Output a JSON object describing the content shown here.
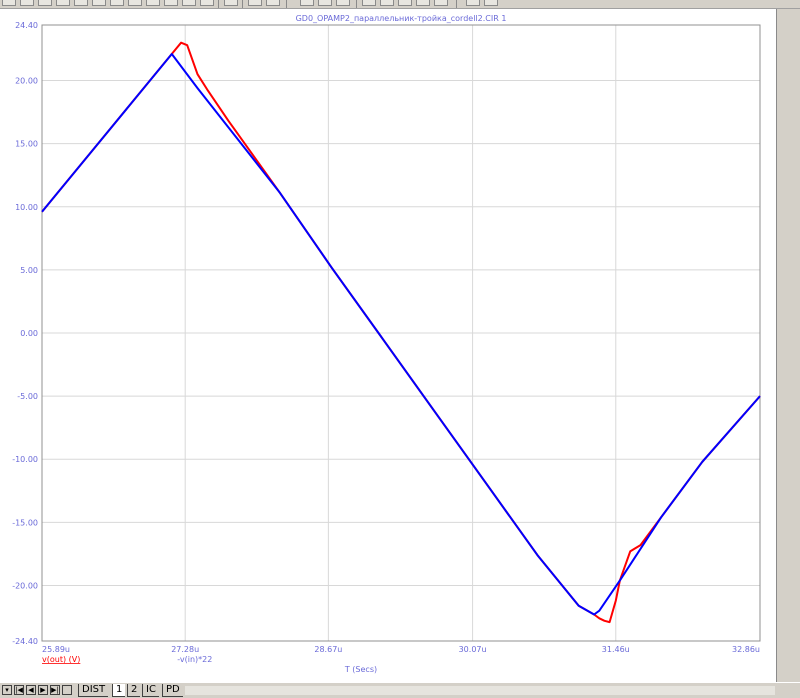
{
  "chart_data": {
    "type": "line",
    "title": "GD0_OPAMP2_параллельник-тройка_cordell2.CIR 1",
    "xlabel": "T (Secs)",
    "x_ticks": [
      "25.89u",
      "27.28u",
      "28.67u",
      "30.07u",
      "31.46u",
      "32.86u"
    ],
    "x_tick_values": [
      25.89,
      27.28,
      28.67,
      30.07,
      31.46,
      32.86
    ],
    "xlim": [
      25.89,
      32.86
    ],
    "y_ticks": [
      "24.40",
      "20.00",
      "15.00",
      "10.00",
      "5.00",
      "0.00",
      "-5.00",
      "-10.00",
      "-15.00",
      "-20.00",
      "-24.40"
    ],
    "y_tick_values": [
      24.4,
      20,
      15,
      10,
      5,
      0,
      -5,
      -10,
      -15,
      -20,
      -24.4
    ],
    "ylim": [
      -24.4,
      24.4
    ],
    "grid": true,
    "legend": "bottom-left",
    "series": [
      {
        "name": "v(out) (V)",
        "color": "#ff0000",
        "x": [
          25.89,
          27.1,
          27.2,
          27.24,
          27.3,
          27.4,
          27.5,
          27.7,
          28.2,
          28.7,
          29.2,
          29.7,
          30.2,
          30.7,
          31.1,
          31.25,
          31.3,
          31.35,
          31.4,
          31.46,
          31.5,
          31.6,
          31.7,
          31.9,
          32.3,
          32.86
        ],
        "y": [
          9.6,
          21.6,
          22.6,
          23.0,
          22.8,
          20.5,
          19.2,
          16.8,
          11.1,
          5.2,
          -0.5,
          -6.2,
          -11.9,
          -17.6,
          -21.6,
          -22.3,
          -22.6,
          -22.8,
          -22.9,
          -21.2,
          -19.6,
          -17.3,
          -16.8,
          -14.6,
          -10.2,
          -5.0
        ]
      },
      {
        "name": "-v(in)*22",
        "color": "#0000ff",
        "x": [
          25.89,
          27.15,
          27.4,
          28.2,
          28.7,
          29.2,
          29.7,
          30.2,
          30.7,
          31.1,
          31.25,
          31.3,
          31.5,
          31.9,
          32.3,
          32.86
        ],
        "y": [
          9.6,
          22.1,
          19.4,
          11.1,
          5.2,
          -0.5,
          -6.2,
          -11.9,
          -17.6,
          -21.6,
          -22.3,
          -22.0,
          -19.6,
          -14.6,
          -10.2,
          -5.0
        ]
      }
    ]
  },
  "statusbar": {
    "tabs": [
      "DIST",
      "1",
      "2",
      "IC",
      "PD"
    ],
    "active_tab": "1",
    "nav_first": "|◀",
    "nav_prev": "◀",
    "nav_next": "▶",
    "nav_last": "▶|",
    "nav_menu": "▾"
  }
}
